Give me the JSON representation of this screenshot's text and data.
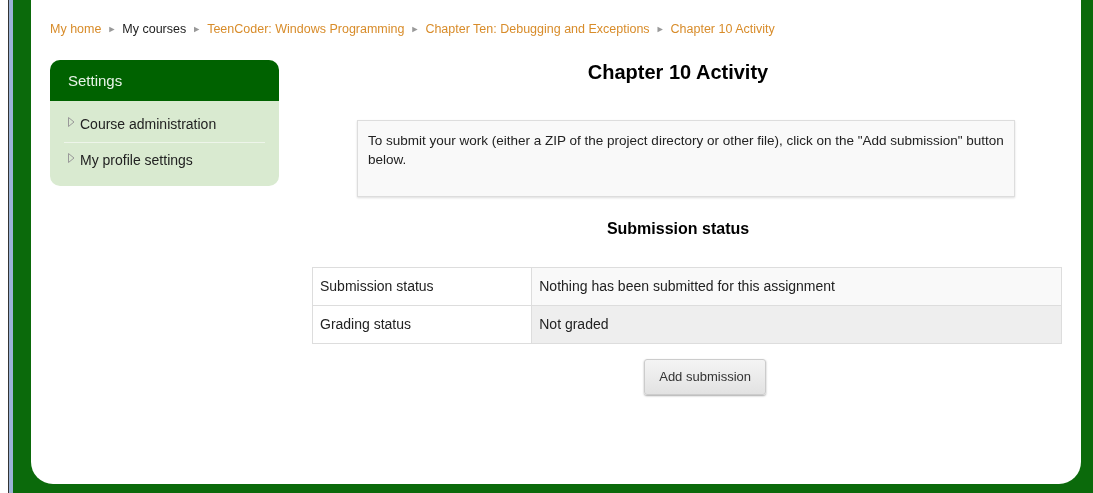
{
  "breadcrumb": [
    {
      "kind": "link",
      "text": "My home"
    },
    {
      "kind": "separator",
      "text": "►"
    },
    {
      "kind": "plain",
      "text": "My courses"
    },
    {
      "kind": "separator",
      "text": "►"
    },
    {
      "kind": "link",
      "text": "TeenCoder: Windows Programming"
    },
    {
      "kind": "separator",
      "text": "►"
    },
    {
      "kind": "link",
      "text": "Chapter Ten: Debugging and Exceptions"
    },
    {
      "kind": "separator",
      "text": "►"
    },
    {
      "kind": "link",
      "text": "Chapter 10 Activity"
    }
  ],
  "settings": {
    "title": "Settings",
    "items": [
      {
        "label": "Course administration",
        "expanded": false
      },
      {
        "label": "My profile settings",
        "expanded": false
      }
    ]
  },
  "page_title": "Chapter 10 Activity",
  "intro": "To submit your work (either a ZIP of the project directory or other file), click on the \"Add submission\" button below.",
  "status_heading": "Submission status",
  "status_table": [
    {
      "label": "Submission status",
      "value": "Nothing has been submitted for this assignment"
    },
    {
      "label": "Grading status",
      "value": "Not graded"
    }
  ],
  "button": "Add submission"
}
